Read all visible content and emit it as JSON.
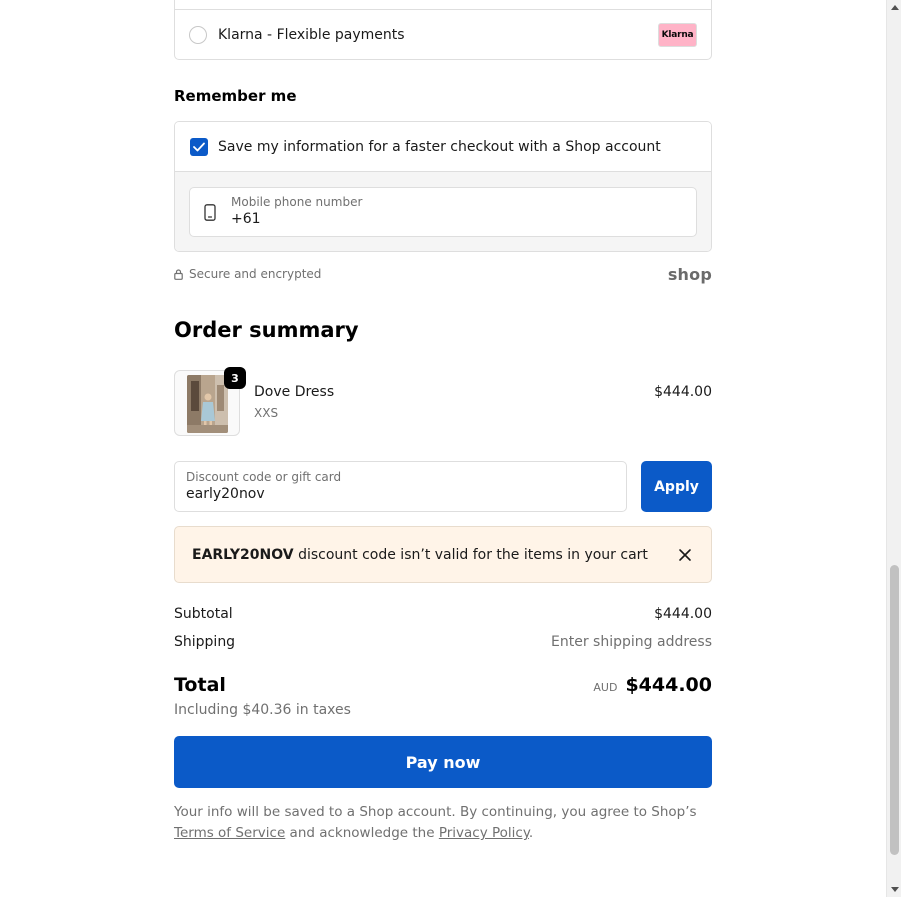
{
  "payment": {
    "klarna_label": "Klarna - Flexible payments",
    "klarna_logo_text": "Klarna"
  },
  "remember": {
    "heading": "Remember me",
    "checkbox_label": "Save my information for a faster checkout with a Shop account",
    "checked": true,
    "phone_label": "Mobile phone number",
    "phone_value": "+61"
  },
  "security": {
    "text": "Secure and encrypted",
    "shop_logo": "shop"
  },
  "order_summary": {
    "heading": "Order summary",
    "items": [
      {
        "name": "Dove Dress",
        "variant": "XXS",
        "quantity": "3",
        "price": "$444.00"
      }
    ]
  },
  "discount": {
    "label": "Discount code or gift card",
    "value": "early20nov",
    "apply_label": "Apply"
  },
  "alert": {
    "code": "EARLY20NOV",
    "message": " discount code isn’t valid for the items in your cart"
  },
  "totals": {
    "subtotal_label": "Subtotal",
    "subtotal_value": "$444.00",
    "shipping_label": "Shipping",
    "shipping_value": "Enter shipping address",
    "total_label": "Total",
    "currency": "AUD",
    "total_value": "$444.00",
    "taxes": "Including $40.36 in taxes"
  },
  "pay_label": "Pay now",
  "legal": {
    "text_1": "Your info will be saved to a Shop account. By continuing, you agree to Shop’s",
    "terms_link": "Terms of Service",
    "text_2": " and acknowledge the ",
    "privacy_link": "Privacy Policy",
    "text_3": "."
  },
  "colors": {
    "primary": "#0b5ac8",
    "alert_bg": "#fff4e8",
    "muted_text": "#707070",
    "border": "#dedede"
  }
}
